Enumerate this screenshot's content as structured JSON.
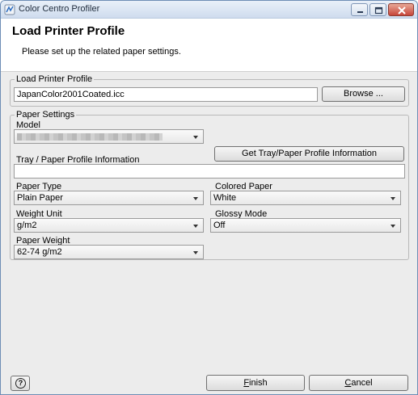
{
  "window": {
    "title": "Color Centro Profiler"
  },
  "header": {
    "title": "Load Printer Profile",
    "subtitle": "Please set up the related paper settings."
  },
  "load_printer_profile": {
    "legend": "Load Printer Profile",
    "file_value": "JapanColor2001Coated.icc",
    "browse_label": "Browse ..."
  },
  "paper_settings": {
    "legend": "Paper Settings",
    "model_label": "Model",
    "model_value": "",
    "tray_info_label": "Tray / Paper Profile Information",
    "tray_info_value": "",
    "get_info_label": "Get Tray/Paper Profile Information",
    "paper_type_label": "Paper Type",
    "paper_type_value": "Plain Paper",
    "colored_paper_label": "Colored Paper",
    "colored_paper_value": "White",
    "weight_unit_label": "Weight Unit",
    "weight_unit_value": "g/m2",
    "glossy_mode_label": "Glossy Mode",
    "glossy_mode_value": "Off",
    "paper_weight_label": "Paper Weight",
    "paper_weight_value": "62-74 g/m2"
  },
  "footer": {
    "help_symbol": "?",
    "finish_mnemonic": "F",
    "finish_rest": "inish",
    "cancel_mnemonic": "C",
    "cancel_rest": "ancel"
  }
}
